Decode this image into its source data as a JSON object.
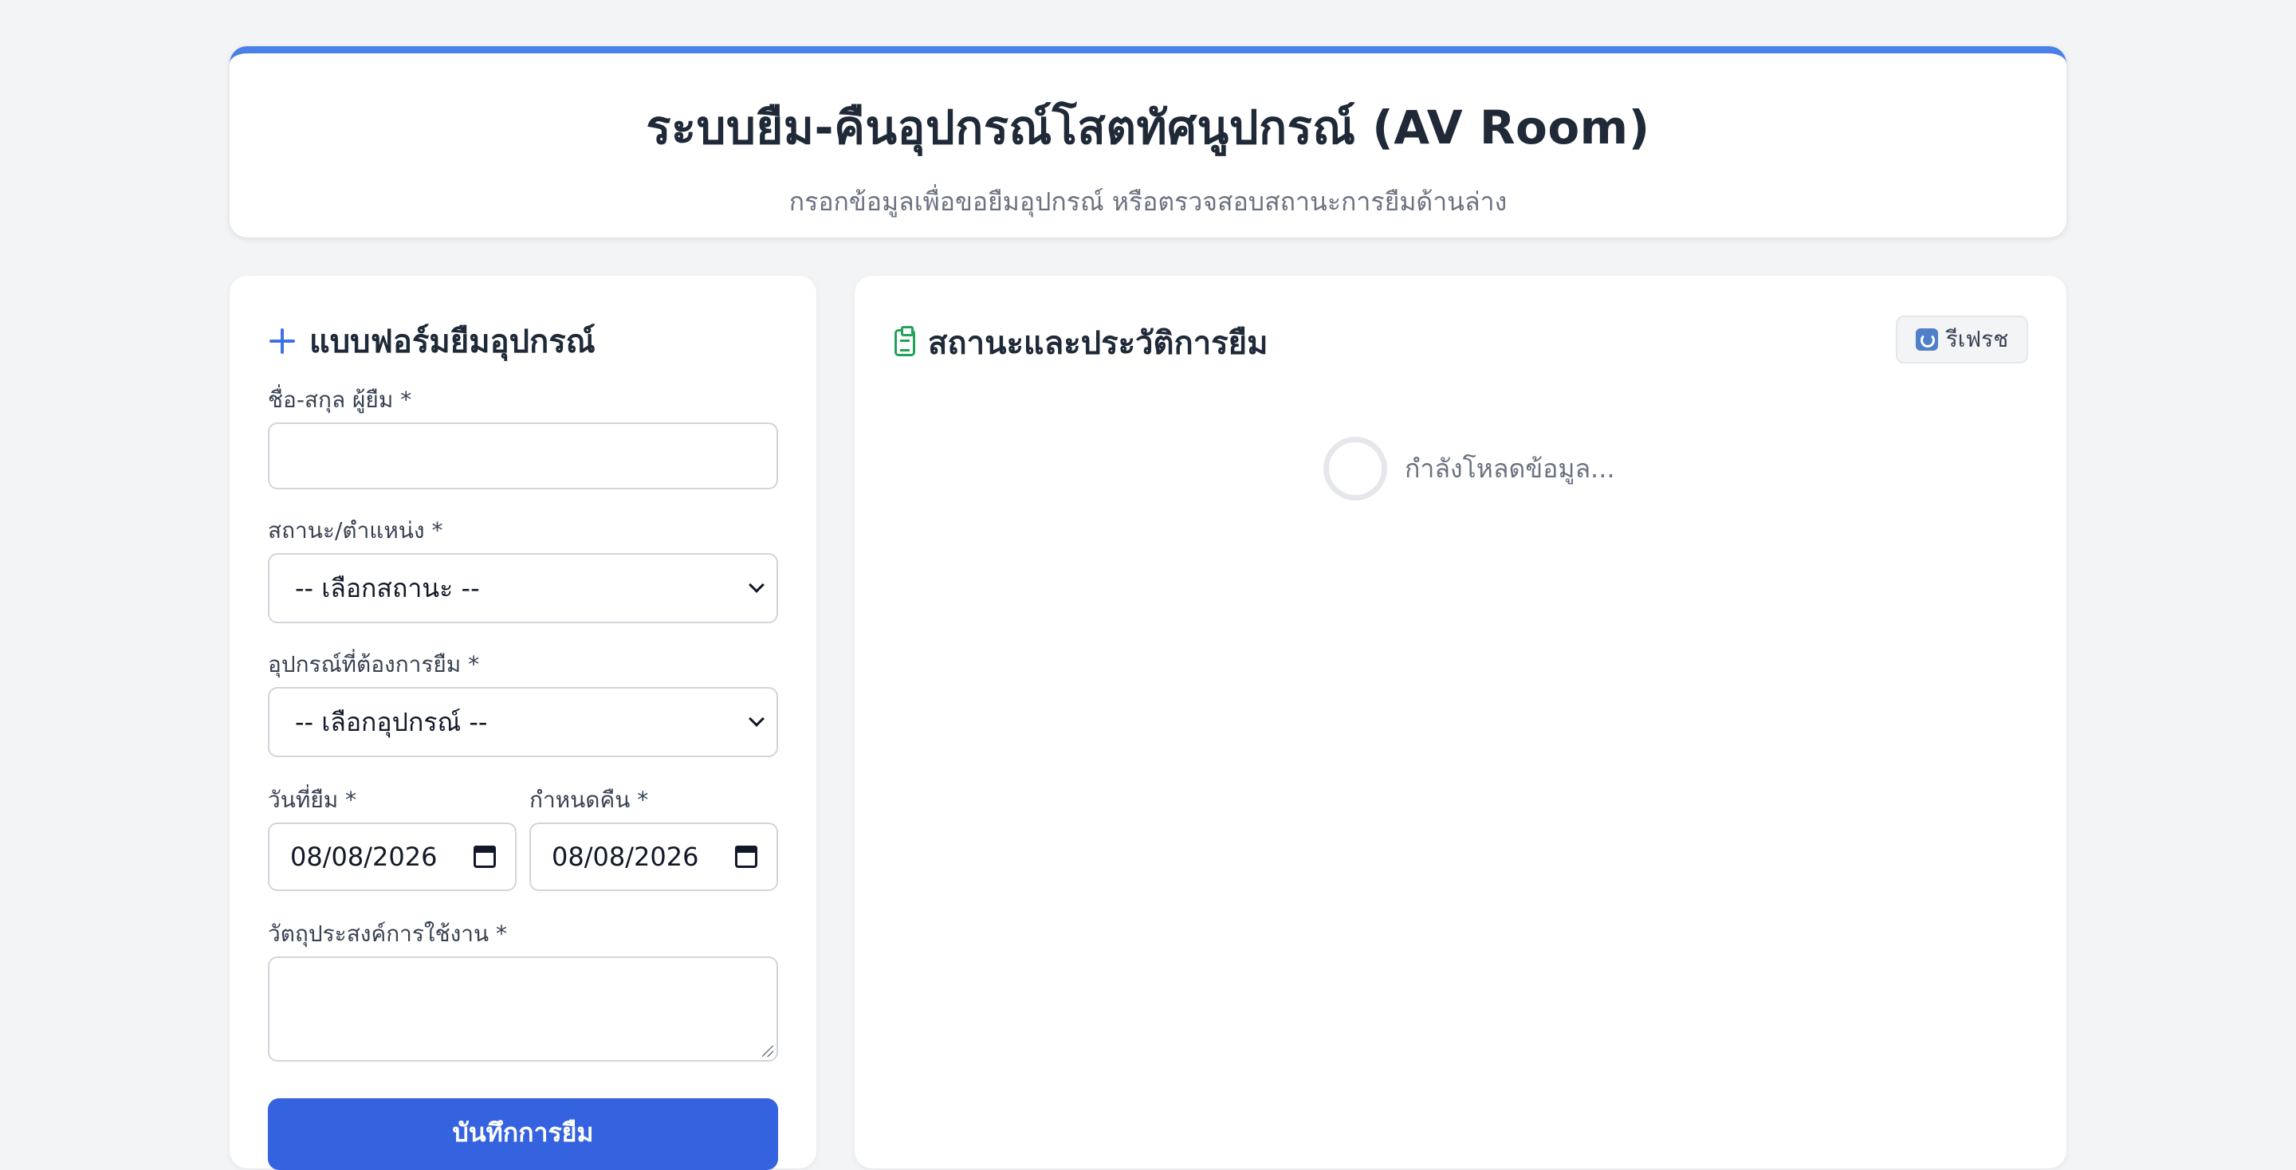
{
  "header": {
    "title": "ระบบยืม-คืนอุปกรณ์โสตทัศนูปกรณ์ (AV Room)",
    "subtitle": "กรอกข้อมูลเพื่อขอยืมอุปกรณ์ หรือตรวจสอบสถานะการยืมด้านล่าง"
  },
  "form": {
    "title": "แบบฟอร์มยืมอุปกรณ์",
    "name_label": "ชื่อ-สกุล ผู้ยืม *",
    "name_value": "",
    "status_label": "สถานะ/ตำแหน่ง *",
    "status_selected": "-- เลือกสถานะ --",
    "equipment_label": "อุปกรณ์ที่ต้องการยืม *",
    "equipment_selected": "-- เลือกอุปกรณ์ --",
    "borrow_date_label": "วันที่ยืม *",
    "borrow_date_value": "08/08/2026",
    "return_date_label": "กำหนดคืน *",
    "return_date_value": "08/08/2026",
    "purpose_label": "วัตถุประสงค์การใช้งาน *",
    "purpose_value": "",
    "submit_label": "บันทึกการยืม"
  },
  "status_panel": {
    "title": "สถานะและประวัติการยืม",
    "refresh_label": "รีเฟรช",
    "loading_text": "กำลังโหลดข้อมูล..."
  },
  "colors": {
    "accent": "#4a80e8",
    "primary_button": "#3563e0",
    "clipboard_icon": "#22a35a"
  }
}
